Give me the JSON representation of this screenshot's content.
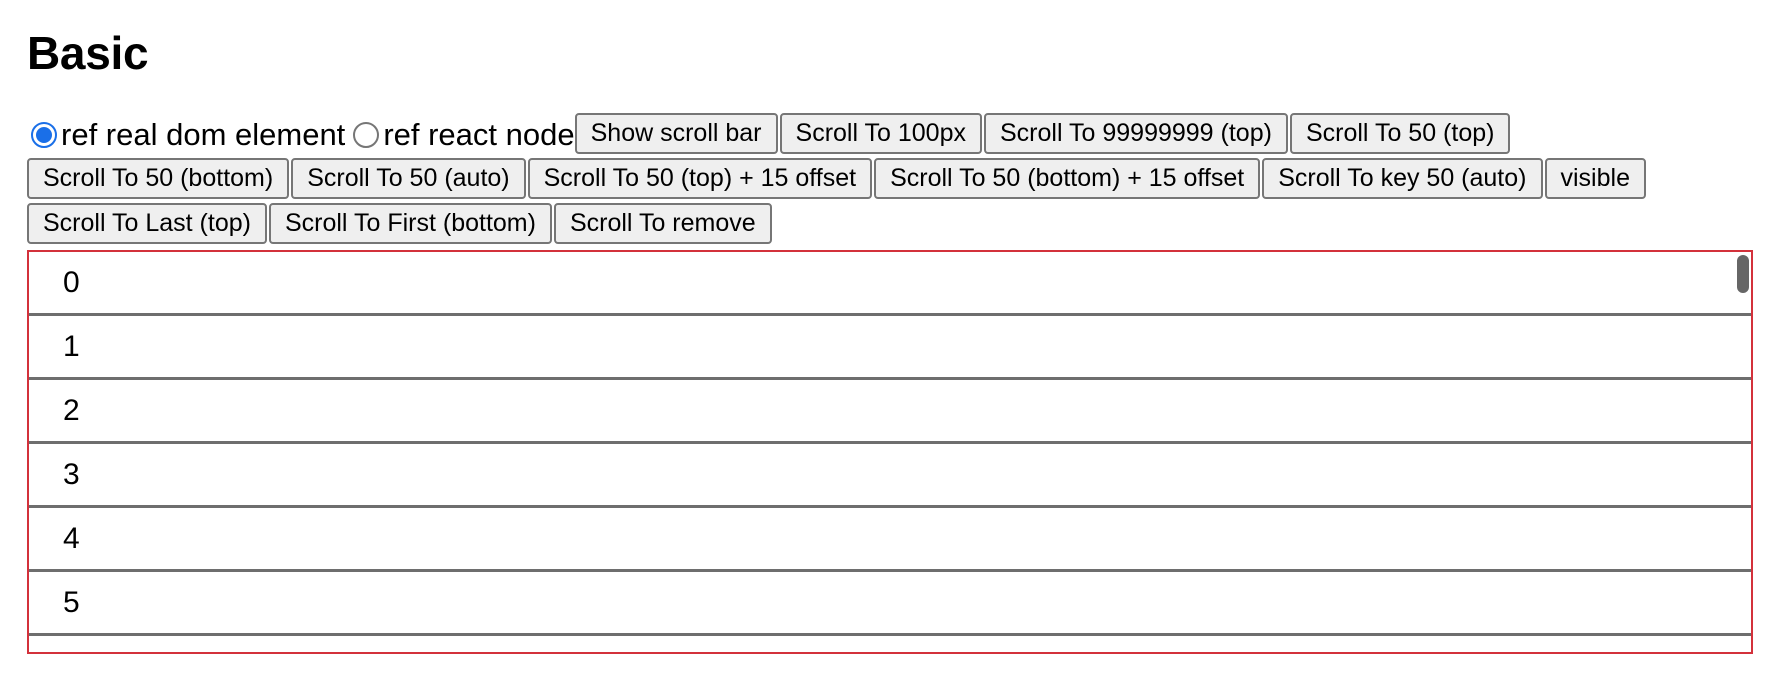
{
  "page": {
    "title": "Basic"
  },
  "radios": [
    {
      "label": "ref real dom element",
      "checked": true
    },
    {
      "label": "ref react node",
      "checked": false
    }
  ],
  "buttons": [
    "Show scroll bar",
    "Scroll To 100px",
    "Scroll To 99999999 (top)",
    "Scroll To 50 (top)",
    "Scroll To 50 (bottom)",
    "Scroll To 50 (auto)",
    "Scroll To 50 (top) + 15 offset",
    "Scroll To 50 (bottom) + 15 offset",
    "Scroll To key 50 (auto)",
    "visible",
    "Scroll To Last (top)",
    "Scroll To First (bottom)",
    "Scroll To remove"
  ],
  "list": {
    "items": [
      "0",
      "1",
      "2",
      "3",
      "4",
      "5",
      ""
    ]
  },
  "colors": {
    "list_border": "#d3313b",
    "radio_accent": "#1a6fe8",
    "row_divider": "#6e6e6e",
    "button_bg": "#efefef"
  }
}
